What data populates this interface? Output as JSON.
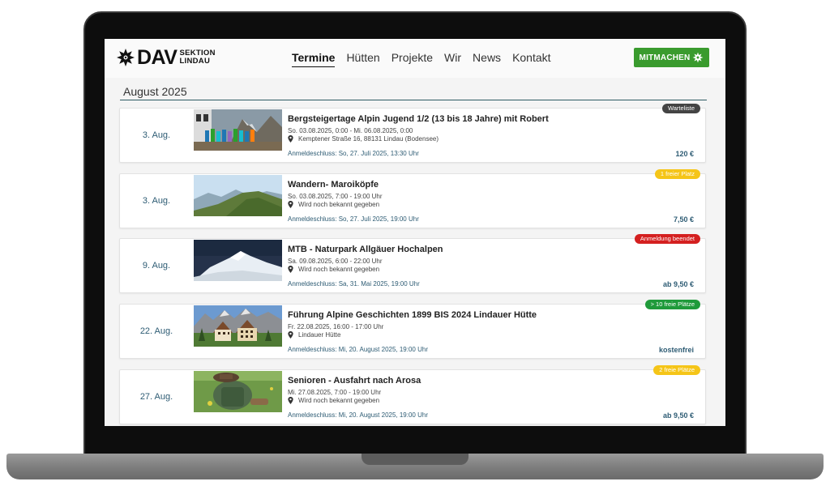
{
  "colors": {
    "accent_teal": "#2e5c74",
    "mitmachen_green": "#3a9b2e",
    "badge_grey": "#444444",
    "badge_yellow": "#f5c518",
    "badge_red": "#d42020",
    "badge_green": "#1f9a3a"
  },
  "header": {
    "logo_main": "DAV",
    "logo_sub_1": "SEKTION",
    "logo_sub_2": "LINDAU",
    "logo_icon": "edelweiss-icon",
    "nav": [
      {
        "label": "Termine",
        "active": true
      },
      {
        "label": "Hütten",
        "active": false
      },
      {
        "label": "Projekte",
        "active": false
      },
      {
        "label": "Wir",
        "active": false
      },
      {
        "label": "News",
        "active": false
      },
      {
        "label": "Kontakt",
        "active": false
      }
    ],
    "cta_label": "MITMACHEN"
  },
  "month": "August 2025",
  "events": [
    {
      "date": "3. Aug.",
      "title": "Bergsteigertage Alpin Jugend 1/2 (13 bis 18 Jahre) mit Robert",
      "time": "So. 03.08.2025, 0:00 - Mi. 06.08.2025, 0:00",
      "location": "Kemptener Straße 16, 88131 Lindau (Bodensee)",
      "deadline": "Anmeldeschluss: So, 27. Juli 2025, 13:30 Uhr",
      "price": "120 €",
      "badge": "Warteliste",
      "badge_color": "#444444",
      "badge_text_color": "#ffffff"
    },
    {
      "date": "3. Aug.",
      "title": "Wandern- Maroiköpfe",
      "time": "So. 03.08.2025, 7:00 - 19:00 Uhr",
      "location": "Wird noch bekannt gegeben",
      "deadline": "Anmeldeschluss: So, 27. Juli 2025, 19:00 Uhr",
      "price": "7,50 €",
      "badge": "1 freier Platz",
      "badge_color": "#f5c518",
      "badge_text_color": "#ffffff"
    },
    {
      "date": "9. Aug.",
      "title": "MTB - Naturpark Allgäuer Hochalpen",
      "time": "Sa. 09.08.2025, 6:00 - 22:00 Uhr",
      "location": "Wird noch bekannt gegeben",
      "deadline": "Anmeldeschluss: Sa, 31. Mai 2025, 19:00 Uhr",
      "price": "ab 9,50 €",
      "badge": "Anmeldung beendet",
      "badge_color": "#d42020",
      "badge_text_color": "#ffffff"
    },
    {
      "date": "22. Aug.",
      "title": "Führung Alpine Geschichten 1899 BIS 2024 Lindauer Hütte",
      "time": "Fr. 22.08.2025, 16:00 - 17:00 Uhr",
      "location": "Lindauer Hütte",
      "deadline": "Anmeldeschluss: Mi, 20. August 2025, 19:00 Uhr",
      "price": "kostenfrei",
      "badge": "> 10 freie Plätze",
      "badge_color": "#1f9a3a",
      "badge_text_color": "#ffffff"
    },
    {
      "date": "27. Aug.",
      "title": "Senioren - Ausfahrt nach Arosa",
      "time": "Mi. 27.08.2025, 7:00 - 19:00 Uhr",
      "location": "Wird noch bekannt gegeben",
      "deadline": "Anmeldeschluss: Mi, 20. August 2025, 19:00 Uhr",
      "price": "ab 9,50 €",
      "badge": "2 freie Plätze",
      "badge_color": "#f5c518",
      "badge_text_color": "#ffffff"
    }
  ]
}
